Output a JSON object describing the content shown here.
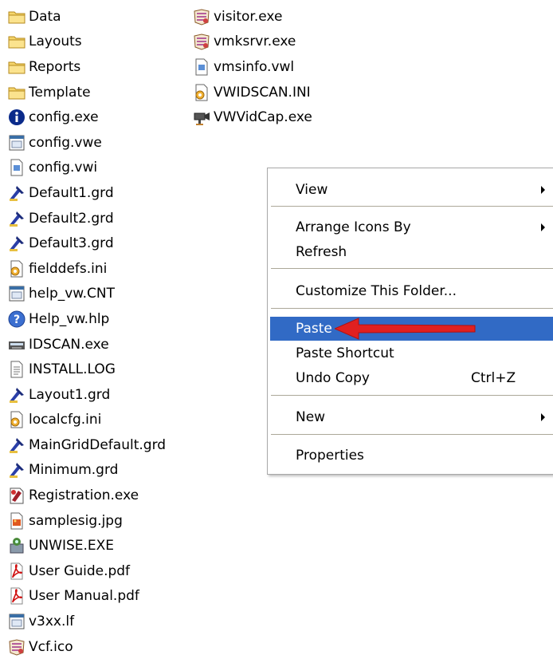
{
  "files_left": [
    {
      "name": "Data",
      "icon": "folder-icon"
    },
    {
      "name": "Layouts",
      "icon": "folder-icon"
    },
    {
      "name": "Reports",
      "icon": "folder-icon"
    },
    {
      "name": "Template",
      "icon": "folder-icon"
    },
    {
      "name": "config.exe",
      "icon": "info-icon"
    },
    {
      "name": "config.vwe",
      "icon": "window-file-icon"
    },
    {
      "name": "config.vwi",
      "icon": "doc-file-icon"
    },
    {
      "name": "Default1.grd",
      "icon": "grd-file-icon"
    },
    {
      "name": "Default2.grd",
      "icon": "grd-file-icon"
    },
    {
      "name": "Default3.grd",
      "icon": "grd-file-icon"
    },
    {
      "name": "fielddefs.ini",
      "icon": "ini-file-icon"
    },
    {
      "name": "help_vw.CNT",
      "icon": "window-file-icon"
    },
    {
      "name": "Help_vw.hlp",
      "icon": "help-icon"
    },
    {
      "name": "IDSCAN.exe",
      "icon": "scanner-icon"
    },
    {
      "name": "INSTALL.LOG",
      "icon": "text-file-icon"
    },
    {
      "name": "Layout1.grd",
      "icon": "grd-file-icon"
    },
    {
      "name": "localcfg.ini",
      "icon": "ini-file-icon"
    },
    {
      "name": "MainGridDefault.grd",
      "icon": "grd-file-icon"
    },
    {
      "name": "Minimum.grd",
      "icon": "grd-file-icon"
    },
    {
      "name": "Registration.exe",
      "icon": "registration-icon"
    },
    {
      "name": "samplesig.jpg",
      "icon": "image-file-icon"
    },
    {
      "name": "UNWISE.EXE",
      "icon": "unwise-icon"
    },
    {
      "name": "User Guide.pdf",
      "icon": "pdf-icon"
    },
    {
      "name": "User Manual.pdf",
      "icon": "pdf-icon"
    },
    {
      "name": "v3xx.lf",
      "icon": "window-file-icon"
    },
    {
      "name": "Vcf.ico",
      "icon": "badge-icon"
    }
  ],
  "files_right": [
    {
      "name": "visitor.exe",
      "icon": "badge-icon"
    },
    {
      "name": "vmksrvr.exe",
      "icon": "badge-icon"
    },
    {
      "name": "vmsinfo.vwl",
      "icon": "doc-file-icon"
    },
    {
      "name": "VWIDSCAN.INI",
      "icon": "ini-file-icon"
    },
    {
      "name": "VWVidCap.exe",
      "icon": "camera-icon"
    }
  ],
  "context_menu": {
    "items": [
      {
        "key": "view",
        "label": "View",
        "submenu": true
      },
      {
        "key": "arrange",
        "label": "Arrange Icons By",
        "submenu": true
      },
      {
        "key": "refresh",
        "label": "Refresh"
      },
      {
        "key": "customize",
        "label": "Customize This Folder..."
      },
      {
        "key": "paste",
        "label": "Paste",
        "highlighted": true
      },
      {
        "key": "paste_shortcut",
        "label": "Paste Shortcut"
      },
      {
        "key": "undo_copy",
        "label": "Undo Copy",
        "shortcut": "Ctrl+Z"
      },
      {
        "key": "new",
        "label": "New",
        "submenu": true
      },
      {
        "key": "properties",
        "label": "Properties"
      }
    ]
  },
  "colors": {
    "highlight": "#316ac5",
    "annotation_arrow": "#e02020",
    "folder": "#f5d56b"
  }
}
